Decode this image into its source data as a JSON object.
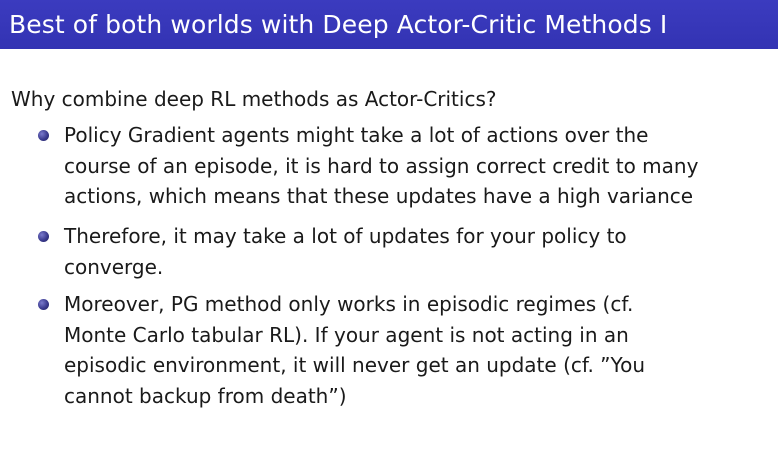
{
  "slide": {
    "title": "Best of both worlds with Deep Actor-Critic Methods I",
    "intro": "Why combine deep RL methods as Actor-Critics?",
    "colors": {
      "title_bar": "#3535b5",
      "title_text": "#ffffff",
      "bullet": "#3b3b8f",
      "body_text": "#1a1a1a"
    },
    "bullets": [
      {
        "lines": [
          "Policy Gradient agents might take a lot of actions over the",
          "course of an episode, it is hard to assign correct credit to many",
          "actions, which means that these updates have a high variance"
        ]
      },
      {
        "lines": [
          "Therefore, it may take a lot of updates for your policy to",
          "converge."
        ]
      },
      {
        "lines": [
          "Moreover, PG method only works in episodic regimes (cf.",
          "Monte Carlo tabular RL). If your agent is not acting in an",
          "episodic environment, it will never get an update (cf. ”You",
          "cannot backup from death”)"
        ]
      }
    ]
  }
}
